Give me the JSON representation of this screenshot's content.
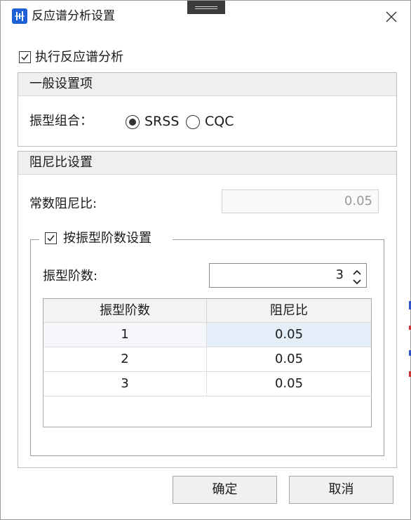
{
  "window": {
    "title": "反应谱分析设置",
    "icon": "app-chart-icon",
    "close_icon": "close-icon"
  },
  "run_analysis": {
    "checked": true,
    "label": "执行反应谱分析"
  },
  "general": {
    "header": "一般设置项",
    "mode_combination_label": "振型组合：",
    "options": [
      {
        "label": "SRSS",
        "selected": true
      },
      {
        "label": "CQC",
        "selected": false
      }
    ]
  },
  "damping": {
    "header": "阻尼比设置",
    "constant_label": "常数阻尼比:",
    "constant_value": "0.05",
    "by_mode": {
      "checked": true,
      "label": "按振型阶数设置",
      "mode_count_label": "振型阶数:",
      "mode_count_value": "3",
      "table": {
        "headers": [
          "振型阶数",
          "阻尼比"
        ],
        "rows": [
          [
            "1",
            "0.05"
          ],
          [
            "2",
            "0.05"
          ],
          [
            "3",
            "0.05"
          ]
        ]
      }
    }
  },
  "buttons": {
    "ok": "确定",
    "cancel": "取消"
  },
  "colors": {
    "accent": "#1e5fd6",
    "selected_cell": "#e3eef8",
    "header_bg": "#efefef"
  }
}
